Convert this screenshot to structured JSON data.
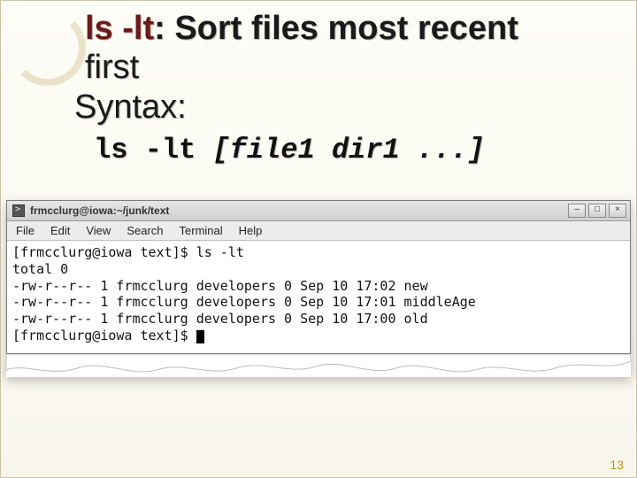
{
  "title": {
    "command": "ls -lt",
    "rest_line1": ": Sort files most recent",
    "rest_line2": "first"
  },
  "syntax": {
    "label": "Syntax:",
    "cmd": "ls -lt ",
    "args": "[file1 dir1 ...]"
  },
  "terminal": {
    "window_title": "frmcclurg@iowa:~/junk/text",
    "menu": {
      "file": "File",
      "edit": "Edit",
      "view": "View",
      "search": "Search",
      "terminal": "Terminal",
      "help": "Help"
    },
    "lines": {
      "l1": "[frmcclurg@iowa text]$ ls -lt",
      "l2": "total 0",
      "l3": "-rw-r--r-- 1 frmcclurg developers 0 Sep 10 17:02 new",
      "l4": "-rw-r--r-- 1 frmcclurg developers 0 Sep 10 17:01 middleAge",
      "l5": "-rw-r--r-- 1 frmcclurg developers 0 Sep 10 17:00 old",
      "l6": "[frmcclurg@iowa text]$ "
    }
  },
  "page_number": "13"
}
